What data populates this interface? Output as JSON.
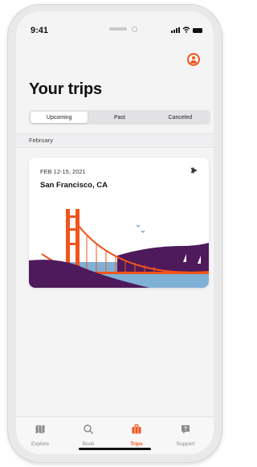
{
  "status": {
    "time": "9:41"
  },
  "page": {
    "title": "Your trips"
  },
  "segments": {
    "upcoming": "Upcoming",
    "past": "Past",
    "canceled": "Canceled"
  },
  "section": {
    "label": "February"
  },
  "trip": {
    "dates": "FEB 12-15, 2021",
    "place": "San Francisco, CA"
  },
  "tabs": {
    "explore": "Explore",
    "book": "Book",
    "trips": "Trips",
    "support": "Support"
  },
  "colors": {
    "accent": "#f2541b",
    "purple": "#4e1a5b",
    "water": "#7fb0d6"
  },
  "icons": [
    "profile-icon",
    "plane-icon",
    "map-icon",
    "search-icon",
    "suitcase-icon",
    "help-icon"
  ]
}
